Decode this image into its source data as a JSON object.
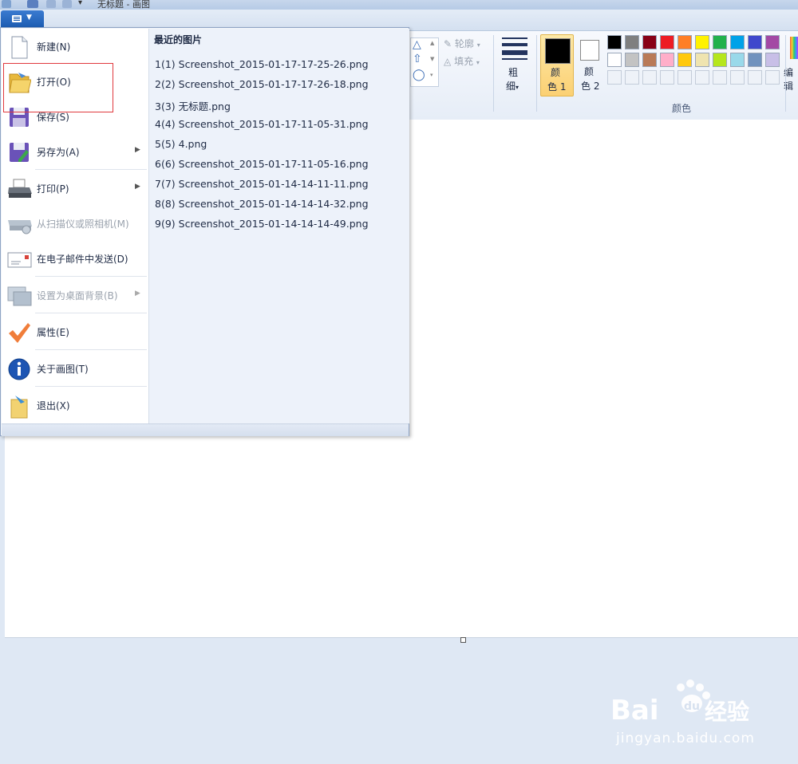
{
  "window": {
    "title": "无标题 - 画图"
  },
  "app_menu": {
    "items": [
      {
        "label": "新建(N)",
        "icon": "new-file-icon",
        "disabled": false,
        "submenu": false
      },
      {
        "label": "打开(O)",
        "icon": "open-folder-icon",
        "disabled": false,
        "submenu": false
      },
      {
        "label": "保存(S)",
        "icon": "save-icon",
        "disabled": false,
        "submenu": false
      },
      {
        "label": "另存为(A)",
        "icon": "save-as-icon",
        "disabled": false,
        "submenu": true
      },
      {
        "label": "打印(P)",
        "icon": "printer-icon",
        "disabled": false,
        "submenu": true
      },
      {
        "label": "从扫描仪或照相机(M)",
        "icon": "scanner-icon",
        "disabled": true,
        "submenu": false
      },
      {
        "label": "在电子邮件中发送(D)",
        "icon": "email-icon",
        "disabled": false,
        "submenu": false
      },
      {
        "label": "设置为桌面背景(B)",
        "icon": "desktop-background-icon",
        "disabled": true,
        "submenu": true
      },
      {
        "label": "属性(E)",
        "icon": "checkmark-icon",
        "disabled": false,
        "submenu": false
      },
      {
        "label": "关于画图(T)",
        "icon": "info-icon",
        "disabled": false,
        "submenu": false
      },
      {
        "label": "退出(X)",
        "icon": "exit-icon",
        "disabled": false,
        "submenu": false
      }
    ],
    "recent_title": "最近的图片",
    "recent": [
      "1(1)  Screenshot_2015-01-17-17-25-26.png",
      "2(2)  Screenshot_2015-01-17-17-26-18.png",
      "3(3)  无标题.png",
      "4(4)  Screenshot_2015-01-17-11-05-31.png",
      "5(5)  4.png",
      "6(6)  Screenshot_2015-01-17-11-05-16.png",
      "7(7)  Screenshot_2015-01-14-14-11-11.png",
      "8(8)  Screenshot_2015-01-14-14-14-32.png",
      "9(9)  Screenshot_2015-01-14-14-14-49.png"
    ]
  },
  "ribbon": {
    "outline_label": "轮廓",
    "fill_label": "填充",
    "size_label_1": "粗",
    "size_label_2": "细",
    "color1_label_1": "颜",
    "color1_label_2": "色 1",
    "color2_label_1": "颜",
    "color2_label_2": "色 2",
    "colors_group_label": "颜色",
    "edit_colors_label": "编辑",
    "color1_value": "#000000",
    "color2_value": "#ffffff",
    "palette_row1": [
      "#000000",
      "#7f7f7f",
      "#880015",
      "#ed1c24",
      "#ff7f27",
      "#fff200",
      "#22b14c",
      "#00a2e8",
      "#3f48cc",
      "#a349a4"
    ],
    "palette_row2": [
      "#ffffff",
      "#c3c3c3",
      "#b97a57",
      "#ffaec9",
      "#ffc90e",
      "#efe4b0",
      "#b5e61d",
      "#99d9ea",
      "#7092be",
      "#c8bfe7"
    ]
  },
  "watermark": {
    "brand": "Bai du 经验",
    "site": "jingyan.baidu.com"
  }
}
